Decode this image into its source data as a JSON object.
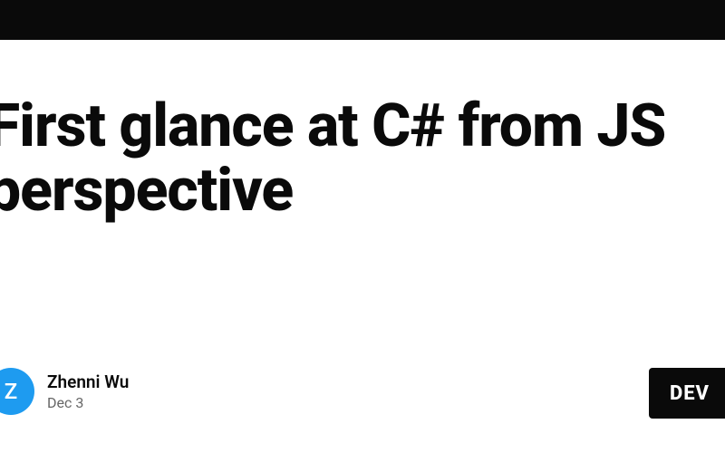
{
  "topbar": {},
  "article": {
    "title": "First glance at C# from JS perspective"
  },
  "author": {
    "initial": "Z",
    "name": "Zhenni Wu",
    "date": "Dec 3"
  },
  "brand": {
    "label": "DEV"
  }
}
